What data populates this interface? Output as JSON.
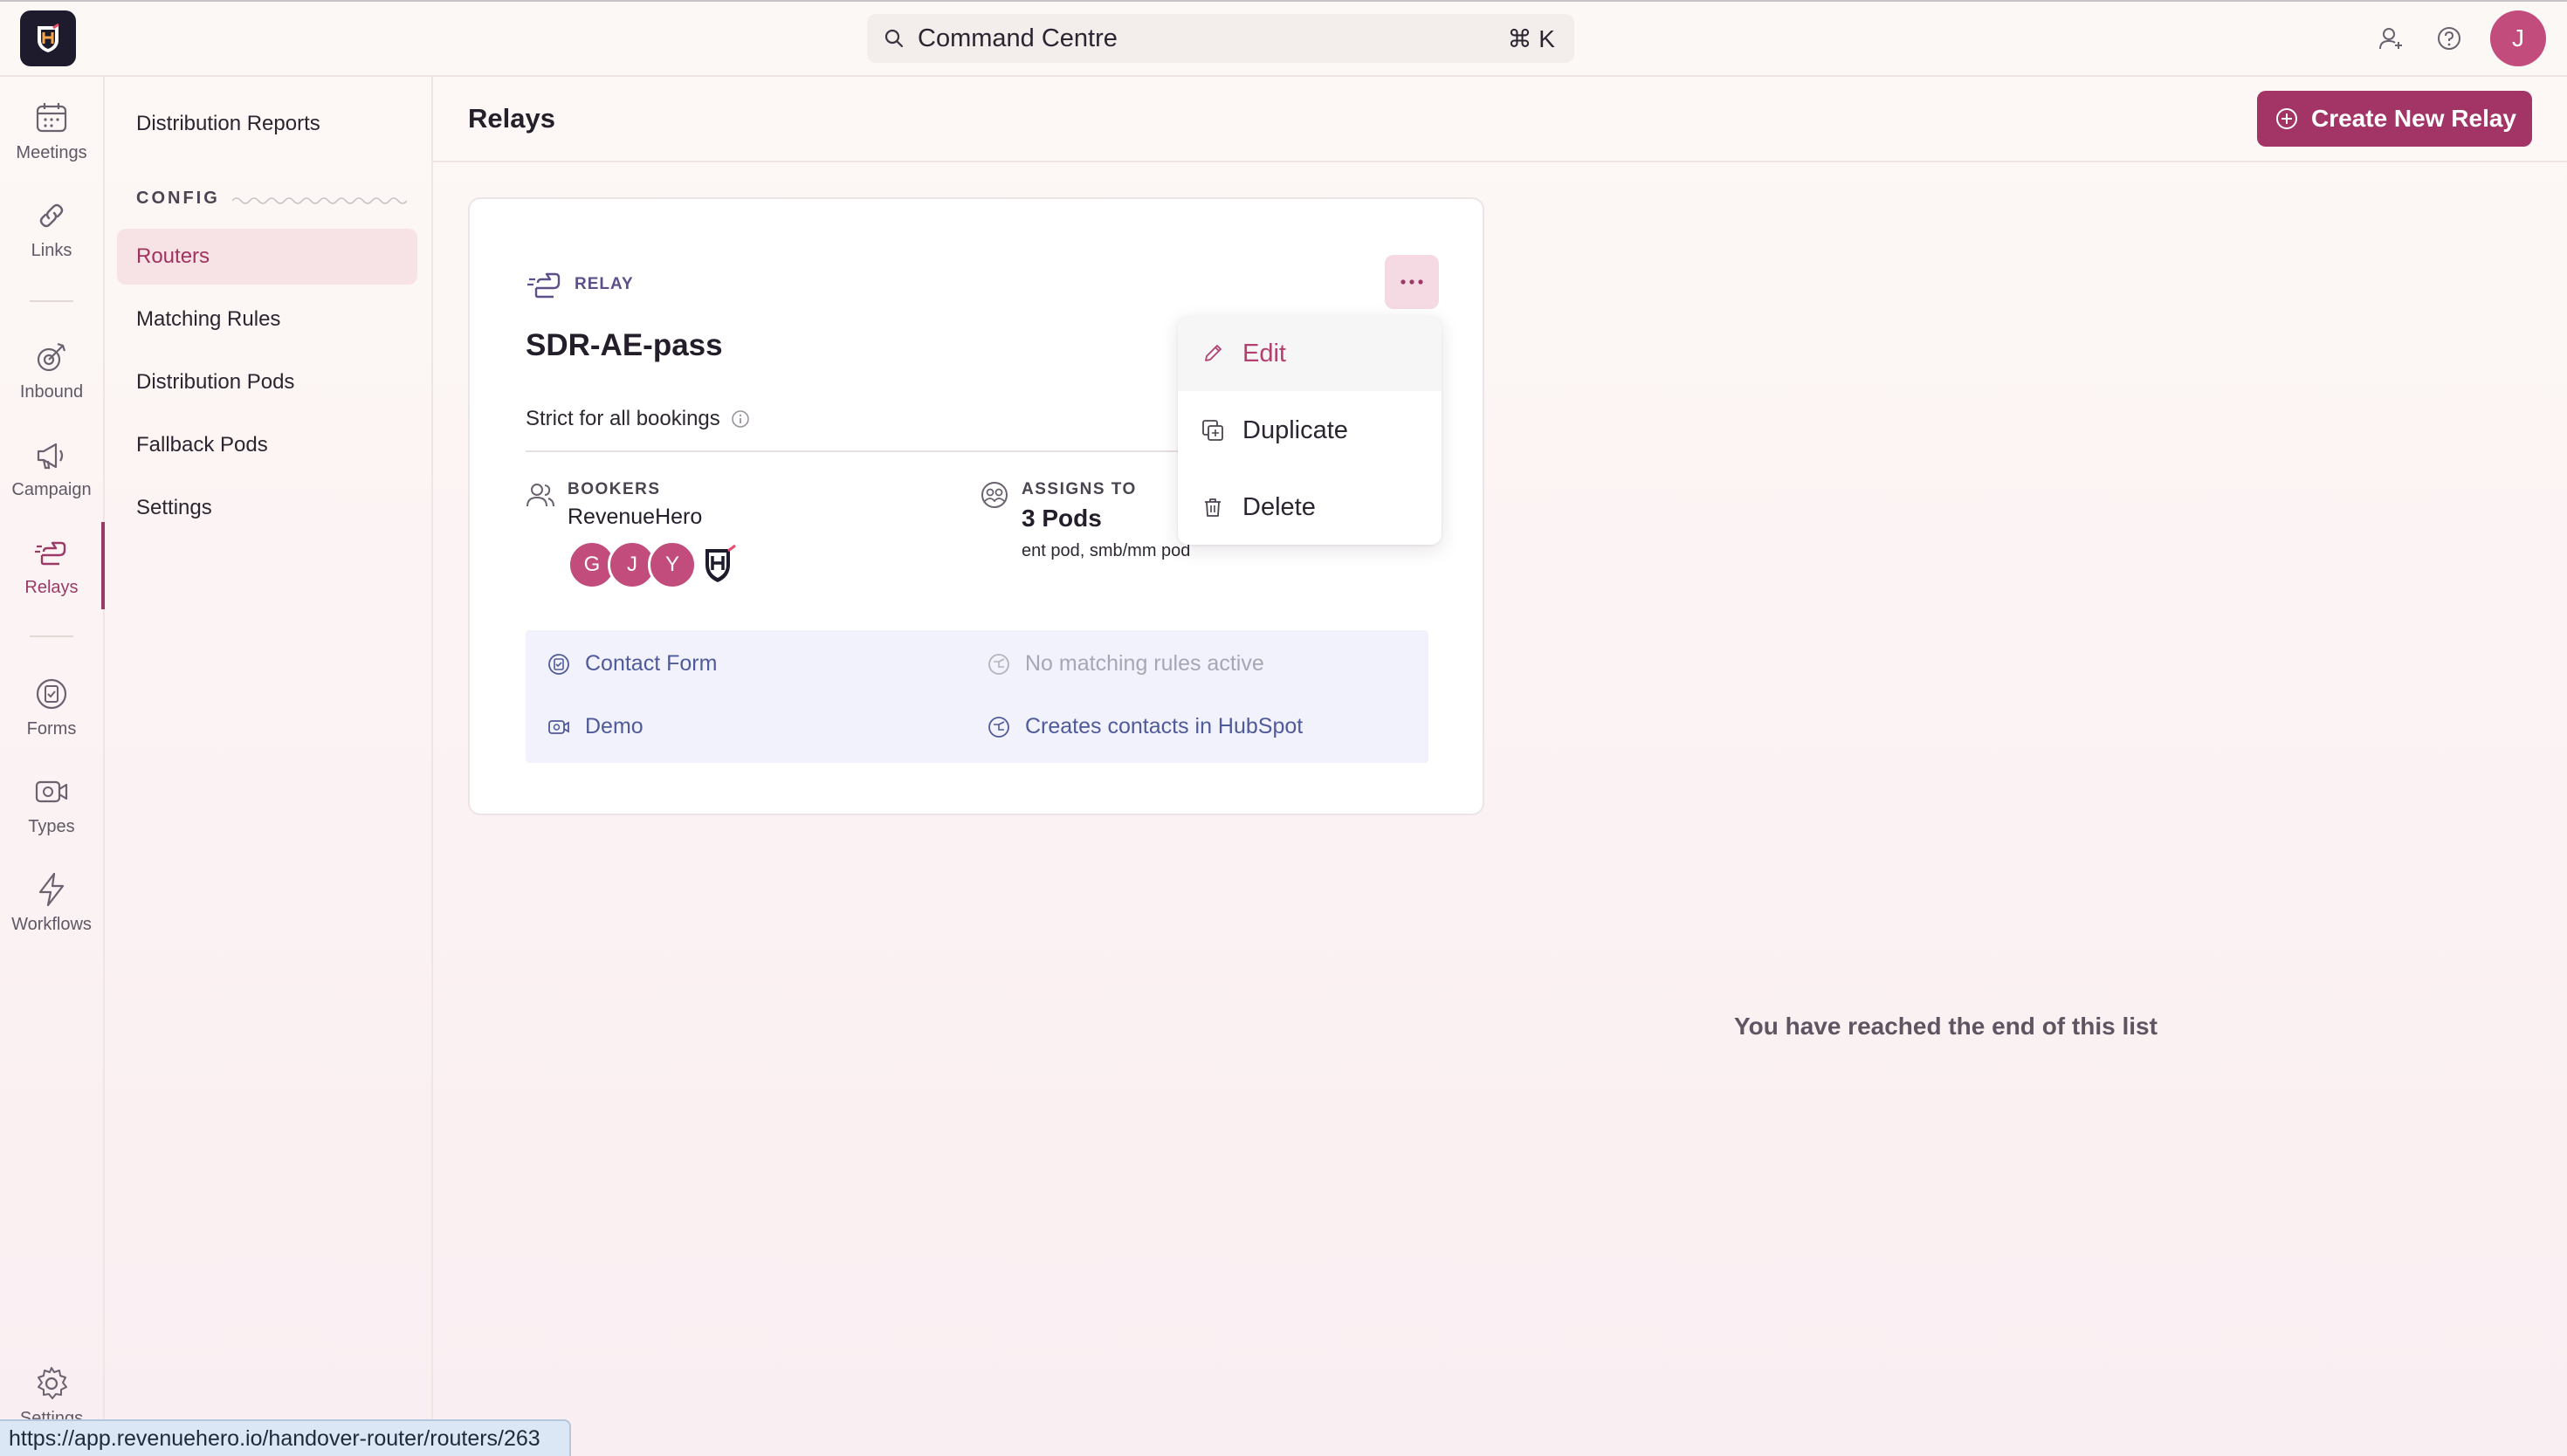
{
  "app": {
    "search_placeholder": "Command Centre",
    "search_shortcut": "⌘ K",
    "user_initial": "J"
  },
  "rail": {
    "items": [
      {
        "label": "Meetings",
        "icon": "calendar-icon"
      },
      {
        "label": "Links",
        "icon": "link-icon"
      },
      {
        "label": "Inbound",
        "icon": "inbound-icon"
      },
      {
        "label": "Campaign",
        "icon": "megaphone-icon"
      },
      {
        "label": "Relays",
        "icon": "relay-icon"
      },
      {
        "label": "Forms",
        "icon": "form-icon"
      },
      {
        "label": "Types",
        "icon": "video-icon"
      },
      {
        "label": "Workflows",
        "icon": "bolt-icon"
      }
    ],
    "settings_label": "Settings",
    "active": "Relays"
  },
  "subnav": {
    "top_item": "Distribution Reports",
    "section_label": "CONFIG",
    "items": [
      "Routers",
      "Matching Rules",
      "Distribution Pods",
      "Fallback Pods",
      "Settings"
    ],
    "active": "Routers"
  },
  "page": {
    "title": "Relays",
    "create_button": "Create New Relay",
    "end_message": "You have reached the end of this list"
  },
  "relay_card": {
    "tag": "RELAY",
    "name": "SDR-AE-pass",
    "strictness": "Strict for all bookings",
    "bookers_label": "BOOKERS",
    "bookers_value": "RevenueHero",
    "booker_avatars": [
      "G",
      "J",
      "Y"
    ],
    "assigns_label": "ASSIGNS TO",
    "assigns_value": "3 Pods",
    "assigns_sub": "ent pod, smb/mm pod",
    "info": {
      "form": "Contact Form",
      "rules": "No matching rules active",
      "meeting_type": "Demo",
      "crm": "Creates contacts in HubSpot"
    }
  },
  "menu": {
    "items": [
      "Edit",
      "Duplicate",
      "Delete"
    ],
    "hovered": "Edit"
  },
  "status_bar": {
    "url": "https://app.revenuehero.io/handover-router/routers/263"
  },
  "colors": {
    "accent": "#a33566",
    "active_bg": "#f7e3e6",
    "info_text": "#4f5a9a"
  }
}
